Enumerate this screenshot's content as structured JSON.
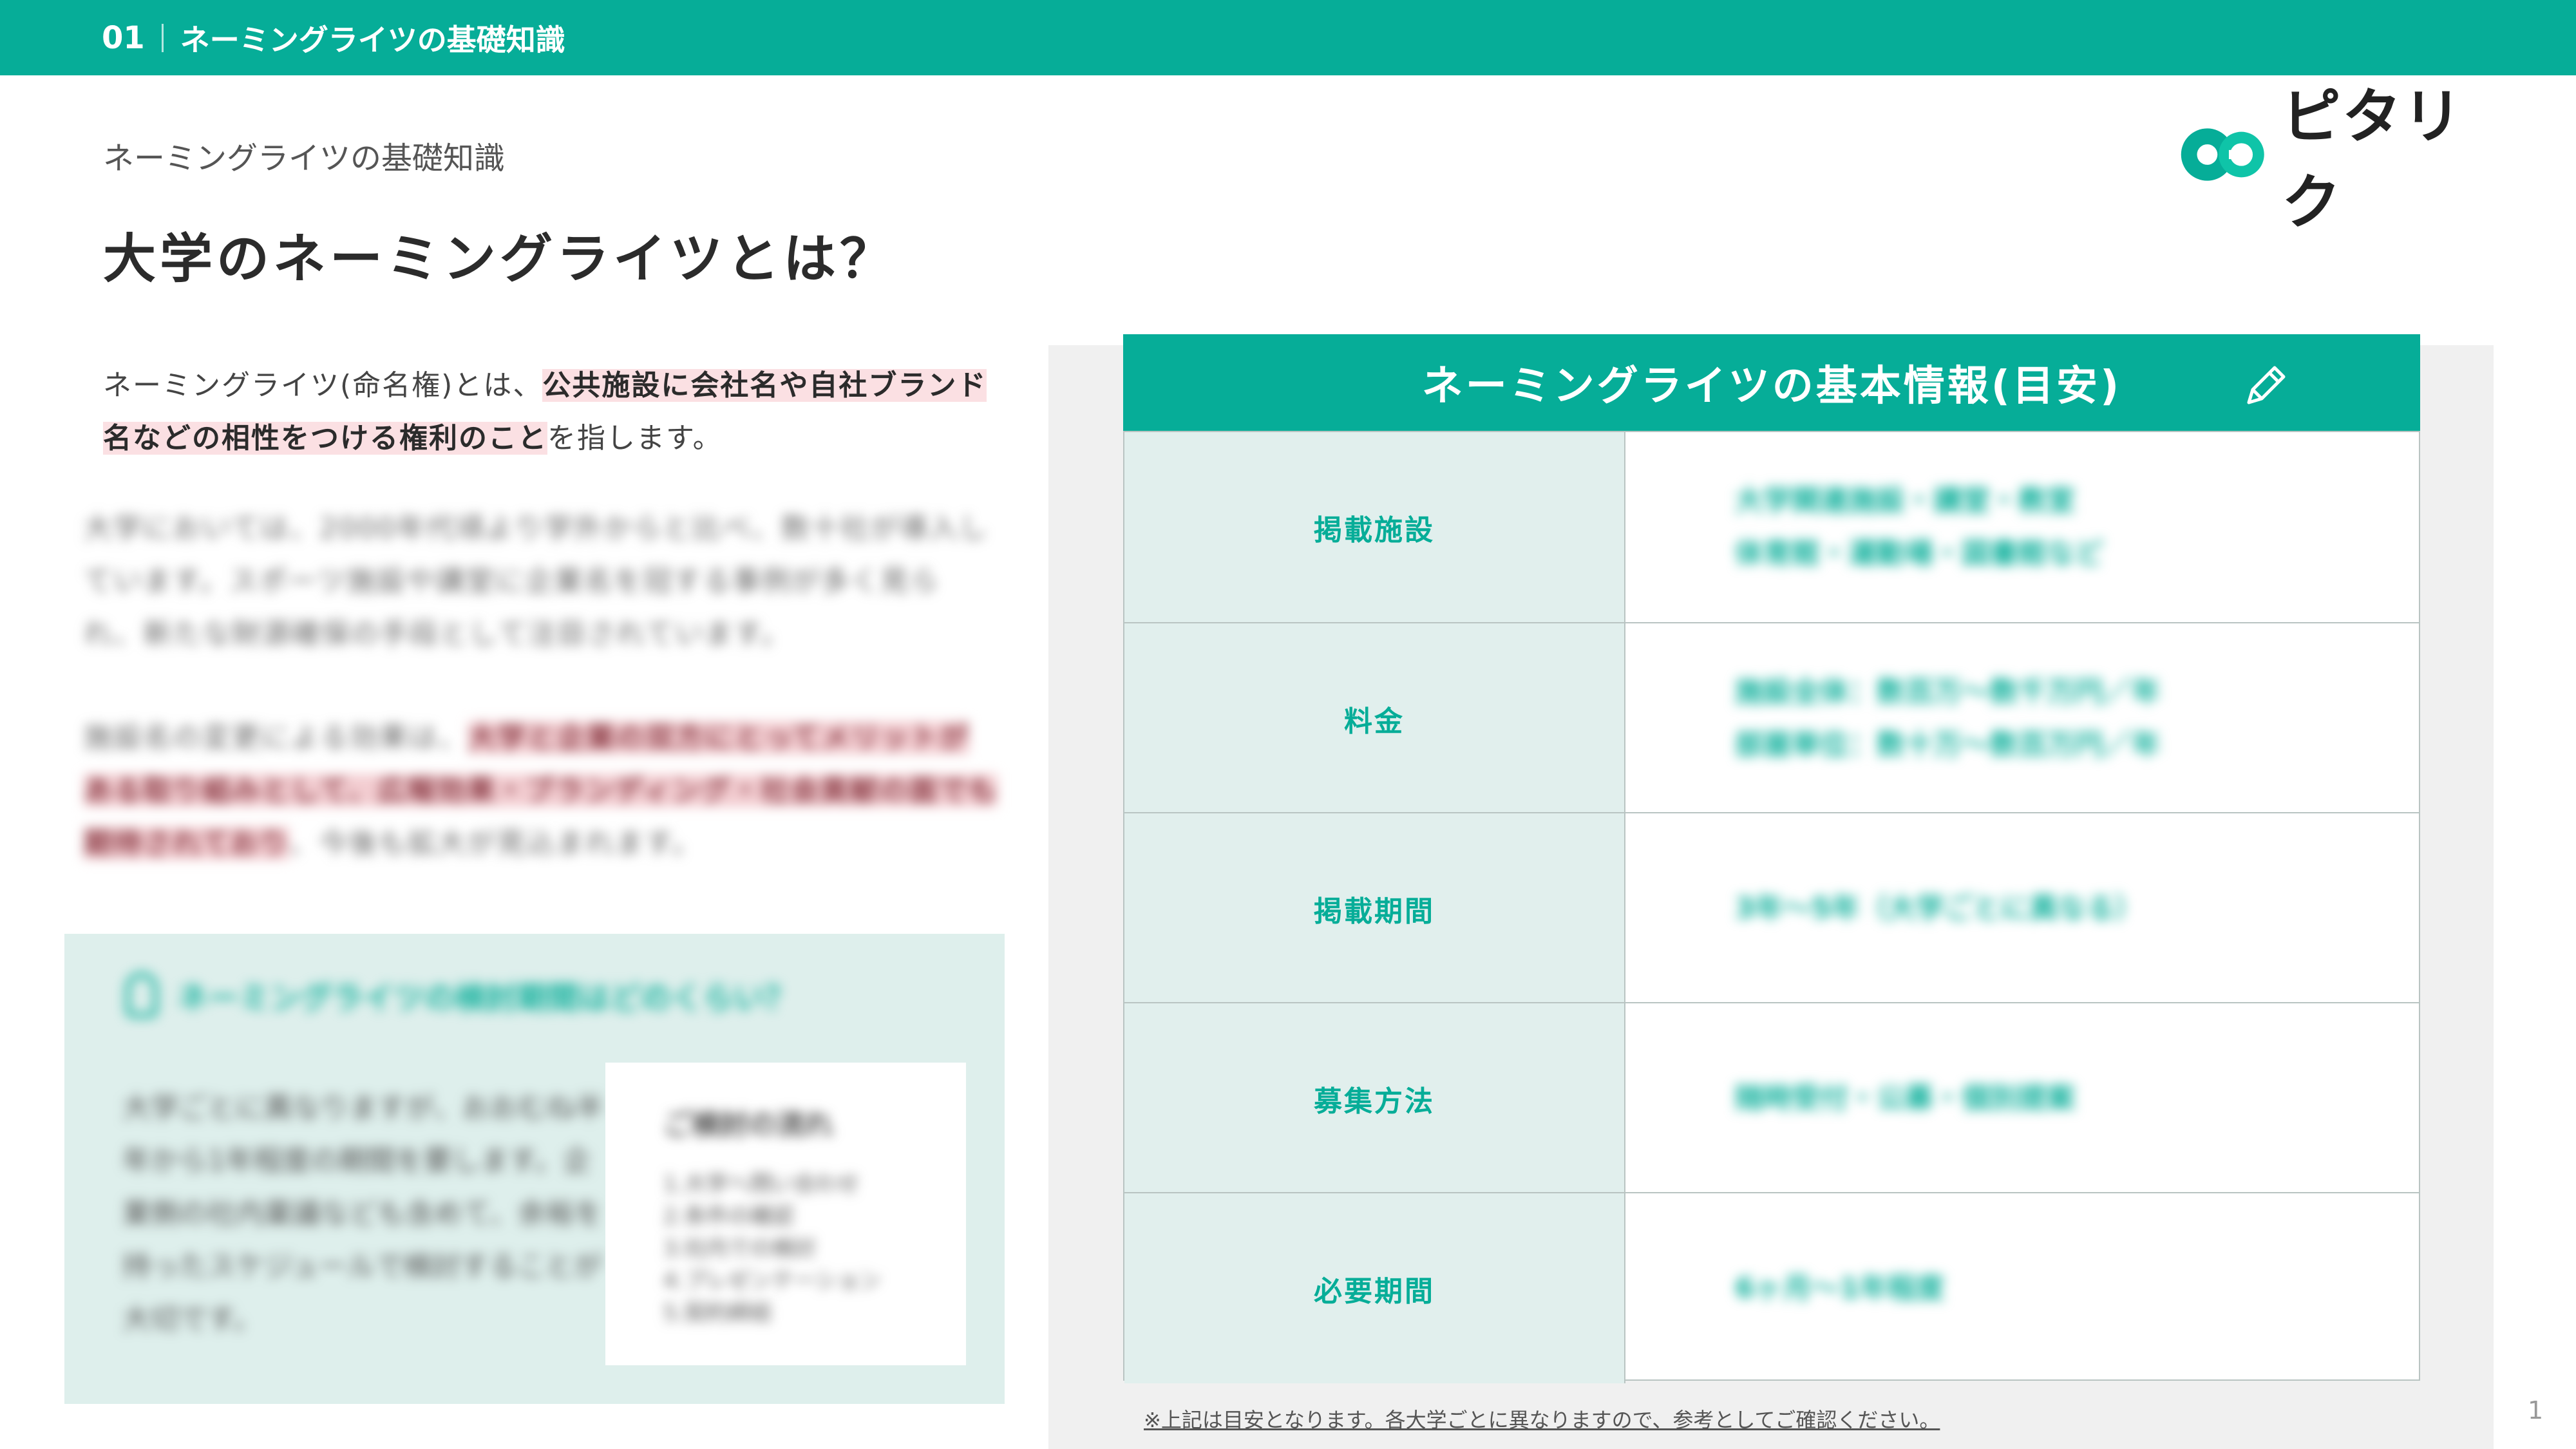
{
  "header": {
    "section_number": "01",
    "section_title": "ネーミングライツの基礎知識"
  },
  "page": {
    "kicker": "ネーミングライツの基礎知識",
    "title": "大学のネーミングライツとは？",
    "page_number": "1"
  },
  "logo": {
    "text": "ピタリク",
    "icon": "pitariku-logo-mark",
    "colors": [
      "#06ad98",
      "#0fc4a8",
      "#222222"
    ]
  },
  "intro": {
    "text_before": "ネーミングライツ(命名権)とは、",
    "highlight": "公共施設に会社名や自社ブランド名などの相性をつける権利のこと",
    "text_after": "を指します。"
  },
  "blurred": {
    "para2": "大学においては、2000年代頃より学外からと比べ、数十社が導入しています。スポーツ施設や講堂に企業名を冠する事例が多く見られ、新たな財源確保の手段として注目されています。",
    "para3_before": "施設名の変更による効果は、",
    "para3_highlight": "大学と企業の双方にとってメリットがある取り組みとして、広報効果・ブランディング・社会貢献の面でも期待されており",
    "para3_after": "、今後も拡大が見込まれます。",
    "tip_title": "ネーミングライツの検討期間はどのくらい？",
    "tip_body": "大学ごとに異なりますが、おおむね半年から1年程度の期間を要します。企業側の社内稟議なども含めて、余裕を持ったスケジュールで検討することが大切です。",
    "tip_card_title": "ご検討の流れ",
    "tip_card_lines": [
      "1.大学へ問い合わせ",
      "2.条件の確認",
      "3.社内での検討",
      "4.プレゼンテーション",
      "5.契約締結"
    ]
  },
  "panel": {
    "title": "ネーミングライツの基本情報(目安)",
    "icon": "pencil-icon",
    "rows": [
      {
        "label": "掲載施設",
        "values": [
          "大学関連施設・講堂・教室",
          "体育館・運動場・図書館など"
        ]
      },
      {
        "label": "料金",
        "values": [
          "施設全体：数百万〜数千万円／年",
          "部屋単位：数十万〜数百万円／年"
        ]
      },
      {
        "label": "掲載期間",
        "values": [
          "3年〜5年（大学ごとに異なる）"
        ]
      },
      {
        "label": "募集方法",
        "values": [
          "随時受付・公募・個別提案"
        ]
      },
      {
        "label": "必要期間",
        "values": [
          "6ヶ月〜1年程度"
        ]
      }
    ],
    "footnote": "※上記は目安となります。各大学ごとに異なりますので、参考としてご確認ください。"
  },
  "colors": {
    "accent": "#06ad98",
    "highlight": "#fbe0e3",
    "label_bg": "#e1efed",
    "panel_bg": "#f0f0f0"
  }
}
